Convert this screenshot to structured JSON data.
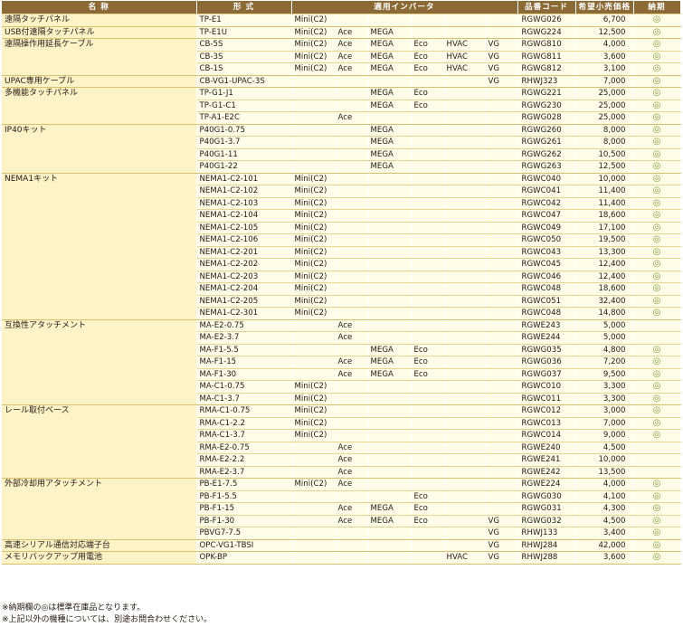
{
  "headers": [
    "名 称",
    "形 式",
    "適用インバータ",
    "品番コード",
    "希望小売価格",
    "納期"
  ],
  "groups": [
    {
      "name": "遠隔タッチパネル",
      "rows": [
        {
          "model": "TP-E1",
          "mini": "Mini(C2)",
          "ace": "",
          "mega": "",
          "eco": "",
          "hvac": "",
          "vg": "",
          "code": "RGWG026",
          "price": "6,700",
          "stock": "◎"
        }
      ]
    },
    {
      "name": "USB付遠隔タッチパネル",
      "rows": [
        {
          "model": "TP-E1U",
          "mini": "Mini(C2)",
          "ace": "Ace",
          "mega": "MEGA",
          "eco": "",
          "hvac": "",
          "vg": "",
          "code": "RGWG224",
          "price": "12,500",
          "stock": "◎"
        }
      ]
    },
    {
      "name": "遠隔操作用延長ケーブル",
      "rows": [
        {
          "model": "CB-5S",
          "mini": "Mini(C2)",
          "ace": "Ace",
          "mega": "MEGA",
          "eco": "Eco",
          "hvac": "HVAC",
          "vg": "VG",
          "code": "RGWG810",
          "price": "4,000",
          "stock": "◎"
        },
        {
          "model": "CB-3S",
          "mini": "Mini(C2)",
          "ace": "Ace",
          "mega": "MEGA",
          "eco": "Eco",
          "hvac": "HVAC",
          "vg": "VG",
          "code": "RGWG811",
          "price": "3,600",
          "stock": "◎"
        },
        {
          "model": "CB-1S",
          "mini": "Mini(C2)",
          "ace": "Ace",
          "mega": "MEGA",
          "eco": "Eco",
          "hvac": "HVAC",
          "vg": "VG",
          "code": "RGWG812",
          "price": "3,100",
          "stock": "◎"
        }
      ]
    },
    {
      "name": "UPAC専用ケーブル",
      "rows": [
        {
          "model": "CB-VG1-UPAC-3S",
          "mini": "",
          "ace": "",
          "mega": "",
          "eco": "",
          "hvac": "",
          "vg": "VG",
          "code": "RHWJ323",
          "price": "7,000",
          "stock": "◎"
        }
      ]
    },
    {
      "name": "多機能タッチパネル",
      "rows": [
        {
          "model": "TP-G1-J1",
          "mini": "",
          "ace": "",
          "mega": "MEGA",
          "eco": "Eco",
          "hvac": "",
          "vg": "",
          "code": "RGWG221",
          "price": "25,000",
          "stock": "◎"
        },
        {
          "model": "TP-G1-C1",
          "mini": "",
          "ace": "",
          "mega": "MEGA",
          "eco": "Eco",
          "hvac": "",
          "vg": "",
          "code": "RGWG230",
          "price": "25,000",
          "stock": "◎"
        },
        {
          "model": "TP-A1-E2C",
          "mini": "",
          "ace": "Ace",
          "mega": "",
          "eco": "",
          "hvac": "",
          "vg": "",
          "code": "RGWG028",
          "price": "25,000",
          "stock": "◎"
        }
      ]
    },
    {
      "name": "IP40キット",
      "rows": [
        {
          "model": "P40G1-0.75",
          "mini": "",
          "ace": "",
          "mega": "MEGA",
          "eco": "",
          "hvac": "",
          "vg": "",
          "code": "RGWG260",
          "price": "8,000",
          "stock": "◎"
        },
        {
          "model": "P40G1-3.7",
          "mini": "",
          "ace": "",
          "mega": "MEGA",
          "eco": "",
          "hvac": "",
          "vg": "",
          "code": "RGWG261",
          "price": "8,000",
          "stock": "◎"
        },
        {
          "model": "P40G1-11",
          "mini": "",
          "ace": "",
          "mega": "MEGA",
          "eco": "",
          "hvac": "",
          "vg": "",
          "code": "RGWG262",
          "price": "10,500",
          "stock": "◎"
        },
        {
          "model": "P40G1-22",
          "mini": "",
          "ace": "",
          "mega": "MEGA",
          "eco": "",
          "hvac": "",
          "vg": "",
          "code": "RGWG263",
          "price": "12,500",
          "stock": "◎"
        }
      ]
    },
    {
      "name": "NEMA1キット",
      "rows": [
        {
          "model": "NEMA1-C2-101",
          "mini": "Mini(C2)",
          "ace": "",
          "mega": "",
          "eco": "",
          "hvac": "",
          "vg": "",
          "code": "RGWC040",
          "price": "10,000",
          "stock": "◎"
        },
        {
          "model": "NEMA1-C2-102",
          "mini": "Mini(C2)",
          "ace": "",
          "mega": "",
          "eco": "",
          "hvac": "",
          "vg": "",
          "code": "RGWC041",
          "price": "11,400",
          "stock": "◎"
        },
        {
          "model": "NEMA1-C2-103",
          "mini": "Mini(C2)",
          "ace": "",
          "mega": "",
          "eco": "",
          "hvac": "",
          "vg": "",
          "code": "RGWC042",
          "price": "11,400",
          "stock": "◎"
        },
        {
          "model": "NEMA1-C2-104",
          "mini": "Mini(C2)",
          "ace": "",
          "mega": "",
          "eco": "",
          "hvac": "",
          "vg": "",
          "code": "RGWC047",
          "price": "18,600",
          "stock": "◎"
        },
        {
          "model": "NEMA1-C2-105",
          "mini": "Mini(C2)",
          "ace": "",
          "mega": "",
          "eco": "",
          "hvac": "",
          "vg": "",
          "code": "RGWC049",
          "price": "17,100",
          "stock": "◎"
        },
        {
          "model": "NEMA1-C2-106",
          "mini": "Mini(C2)",
          "ace": "",
          "mega": "",
          "eco": "",
          "hvac": "",
          "vg": "",
          "code": "RGWC050",
          "price": "19,500",
          "stock": "◎"
        },
        {
          "model": "NEMA1-C2-201",
          "mini": "Mini(C2)",
          "ace": "",
          "mega": "",
          "eco": "",
          "hvac": "",
          "vg": "",
          "code": "RGWC043",
          "price": "13,300",
          "stock": "◎"
        },
        {
          "model": "NEMA1-C2-202",
          "mini": "Mini(C2)",
          "ace": "",
          "mega": "",
          "eco": "",
          "hvac": "",
          "vg": "",
          "code": "RGWC045",
          "price": "12,400",
          "stock": "◎"
        },
        {
          "model": "NEMA1-C2-203",
          "mini": "Mini(C2)",
          "ace": "",
          "mega": "",
          "eco": "",
          "hvac": "",
          "vg": "",
          "code": "RGWC046",
          "price": "12,400",
          "stock": "◎"
        },
        {
          "model": "NEMA1-C2-204",
          "mini": "Mini(C2)",
          "ace": "",
          "mega": "",
          "eco": "",
          "hvac": "",
          "vg": "",
          "code": "RGWC048",
          "price": "18,600",
          "stock": "◎"
        },
        {
          "model": "NEMA1-C2-205",
          "mini": "Mini(C2)",
          "ace": "",
          "mega": "",
          "eco": "",
          "hvac": "",
          "vg": "",
          "code": "RGWC051",
          "price": "32,400",
          "stock": "◎"
        },
        {
          "model": "NEMA1-C2-301",
          "mini": "Mini(C2)",
          "ace": "",
          "mega": "",
          "eco": "",
          "hvac": "",
          "vg": "",
          "code": "RGWC048",
          "price": "14,800",
          "stock": "◎"
        }
      ]
    },
    {
      "name": "互換性アタッチメント",
      "rows": [
        {
          "model": "MA-E2-0.75",
          "mini": "",
          "ace": "Ace",
          "mega": "",
          "eco": "",
          "hvac": "",
          "vg": "",
          "code": "RGWE243",
          "price": "5,000",
          "stock": ""
        },
        {
          "model": "MA-E2-3.7",
          "mini": "",
          "ace": "Ace",
          "mega": "",
          "eco": "",
          "hvac": "",
          "vg": "",
          "code": "RGWE244",
          "price": "5,000",
          "stock": ""
        },
        {
          "model": "MA-F1-5.5",
          "mini": "",
          "ace": "",
          "mega": "MEGA",
          "eco": "Eco",
          "hvac": "",
          "vg": "",
          "code": "RGWG035",
          "price": "4,800",
          "stock": "◎"
        },
        {
          "model": "MA-F1-15",
          "mini": "",
          "ace": "Ace",
          "mega": "MEGA",
          "eco": "Eco",
          "hvac": "",
          "vg": "",
          "code": "RGWG036",
          "price": "7,200",
          "stock": "◎"
        },
        {
          "model": "MA-F1-30",
          "mini": "",
          "ace": "Ace",
          "mega": "MEGA",
          "eco": "Eco",
          "hvac": "",
          "vg": "",
          "code": "RGWG037",
          "price": "9,500",
          "stock": "◎"
        },
        {
          "model": "MA-C1-0.75",
          "mini": "Mini(C2)",
          "ace": "",
          "mega": "",
          "eco": "",
          "hvac": "",
          "vg": "",
          "code": "RGWC010",
          "price": "3,300",
          "stock": "◎"
        },
        {
          "model": "MA-C1-3.7",
          "mini": "Mini(C2)",
          "ace": "",
          "mega": "",
          "eco": "",
          "hvac": "",
          "vg": "",
          "code": "RGWC011",
          "price": "3,300",
          "stock": "◎"
        }
      ]
    },
    {
      "name": "レール取付ベース",
      "rows": [
        {
          "model": "RMA-C1-0.75",
          "mini": "Mini(C2)",
          "ace": "",
          "mega": "",
          "eco": "",
          "hvac": "",
          "vg": "",
          "code": "RGWC012",
          "price": "3,000",
          "stock": "◎"
        },
        {
          "model": "RMA-C1-2.2",
          "mini": "Mini(C2)",
          "ace": "",
          "mega": "",
          "eco": "",
          "hvac": "",
          "vg": "",
          "code": "RGWC013",
          "price": "7,000",
          "stock": "◎"
        },
        {
          "model": "RMA-C1-3.7",
          "mini": "Mini(C2)",
          "ace": "",
          "mega": "",
          "eco": "",
          "hvac": "",
          "vg": "",
          "code": "RGWC014",
          "price": "9,000",
          "stock": "◎"
        },
        {
          "model": "RMA-E2-0.75",
          "mini": "",
          "ace": "Ace",
          "mega": "",
          "eco": "",
          "hvac": "",
          "vg": "",
          "code": "RGWE240",
          "price": "4,500",
          "stock": ""
        },
        {
          "model": "RMA-E2-2.2",
          "mini": "",
          "ace": "Ace",
          "mega": "",
          "eco": "",
          "hvac": "",
          "vg": "",
          "code": "RGWE241",
          "price": "10,000",
          "stock": ""
        },
        {
          "model": "RMA-E2-3.7",
          "mini": "",
          "ace": "Ace",
          "mega": "",
          "eco": "",
          "hvac": "",
          "vg": "",
          "code": "RGWE242",
          "price": "13,500",
          "stock": ""
        }
      ]
    },
    {
      "name": "外部冷却用アタッチメント",
      "rows": [
        {
          "model": "PB-E1-7.5",
          "mini": "Mini(C2)",
          "ace": "Ace",
          "mega": "",
          "eco": "",
          "hvac": "",
          "vg": "",
          "code": "RGWE224",
          "price": "4,000",
          "stock": "◎"
        },
        {
          "model": "PB-F1-5.5",
          "mini": "",
          "ace": "",
          "mega": "",
          "eco": "Eco",
          "hvac": "",
          "vg": "",
          "code": "RGWG030",
          "price": "4,100",
          "stock": "◎"
        },
        {
          "model": "PB-F1-15",
          "mini": "",
          "ace": "Ace",
          "mega": "MEGA",
          "eco": "Eco",
          "hvac": "",
          "vg": "",
          "code": "RGWG031",
          "price": "4,300",
          "stock": "◎"
        },
        {
          "model": "PB-F1-30",
          "mini": "",
          "ace": "Ace",
          "mega": "MEGA",
          "eco": "Eco",
          "hvac": "",
          "vg": "VG",
          "code": "RGWG032",
          "price": "4,500",
          "stock": "◎"
        },
        {
          "model": "PBVG7-7.5",
          "mini": "",
          "ace": "",
          "mega": "",
          "eco": "",
          "hvac": "",
          "vg": "VG",
          "code": "RHWJ133",
          "price": "3,400",
          "stock": "◎"
        }
      ]
    },
    {
      "name": "高速シリアル通信対応端子台",
      "rows": [
        {
          "model": "OPC-VG1-TBSI",
          "mini": "",
          "ace": "",
          "mega": "",
          "eco": "",
          "hvac": "",
          "vg": "VG",
          "code": "RHWJ284",
          "price": "42,000",
          "stock": "◎"
        }
      ]
    },
    {
      "name": "メモリバックアップ用電池",
      "rows": [
        {
          "model": "OPK-BP",
          "mini": "",
          "ace": "",
          "mega": "",
          "eco": "",
          "hvac": "HVAC",
          "vg": "VG",
          "code": "RHWJ288",
          "price": "3,600",
          "stock": "◎"
        }
      ]
    }
  ],
  "notes": [
    "※納期欄の◎は標準在庫品となります。",
    "※上記以外の機種については、別途お問合わせください。"
  ]
}
